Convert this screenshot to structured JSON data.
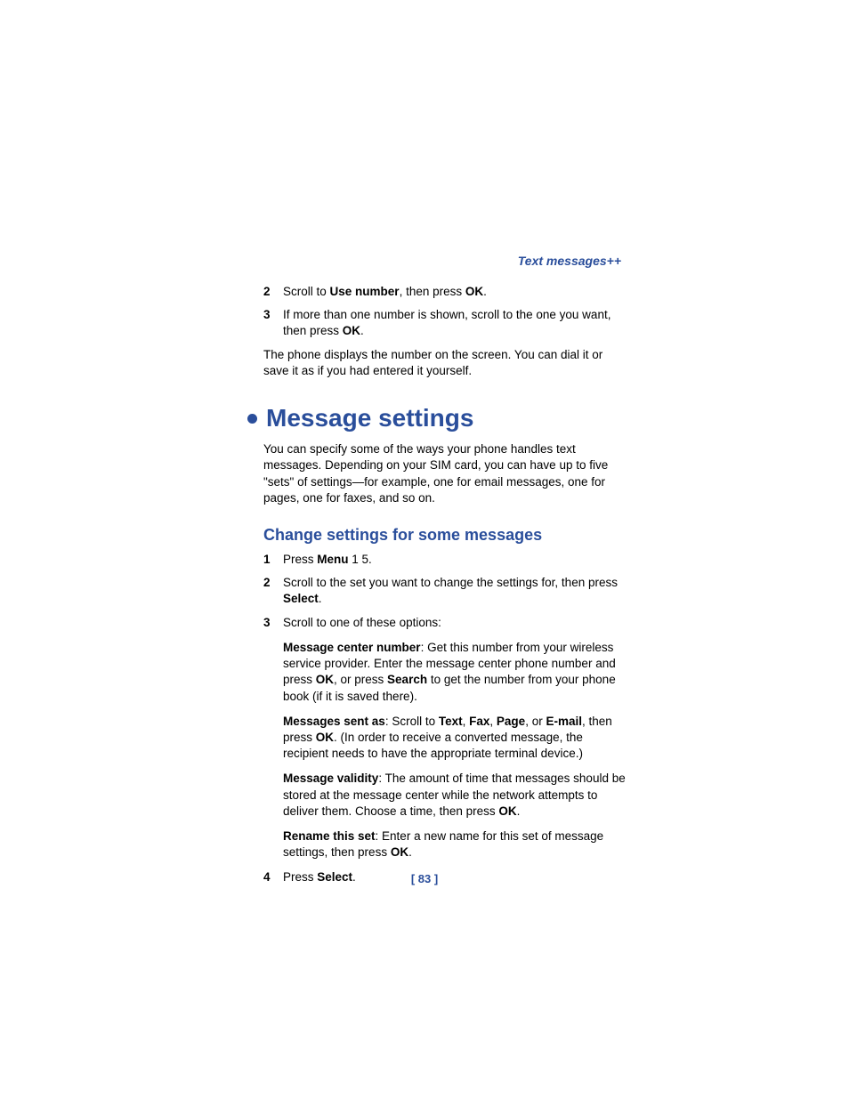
{
  "header": "Text messages++",
  "intro_steps": [
    {
      "num": "2",
      "pre": "Scroll to ",
      "bold1": "Use number",
      "mid": ", then press ",
      "bold2": "OK",
      "post": "."
    },
    {
      "num": "3",
      "pre": "If more than one number is shown, scroll to the one you want, then press ",
      "bold1": "OK",
      "mid": "",
      "bold2": "",
      "post": "."
    }
  ],
  "intro_para": "The phone displays the number on the screen. You can dial it or save it as if you had entered it yourself.",
  "h1": "Message settings",
  "h1_para": "You can specify some of the ways your phone handles text messages. Depending on your SIM card, you can have up to five \"sets\" of settings—for example, one for email messages, one for pages, one for faxes, and so on.",
  "h2": "Change settings for some messages",
  "steps": {
    "s1": {
      "num": "1",
      "press": "Press ",
      "menu": "Menu",
      "tail": " 1 5."
    },
    "s2": {
      "num": "2",
      "pre": "Scroll to the set you want to change the settings for, then press ",
      "bold": "Select",
      "post": "."
    },
    "s3": {
      "num": "3",
      "text": "Scroll to one of these options:"
    },
    "s4": {
      "num": "4",
      "press": "Press ",
      "bold": "Select",
      "post": "."
    }
  },
  "options": {
    "o1": {
      "label": "Message center number",
      "t1": ":  Get this number from your wireless service provider. Enter the message center phone number and press ",
      "b1": "OK",
      "t2": ", or press ",
      "b2": "Search",
      "t3": " to get the number from your phone book (if it is saved there)."
    },
    "o2": {
      "label": "Messages sent as",
      "t1": ":  Scroll to ",
      "b1": "Text",
      "t2": ", ",
      "b2": "Fax",
      "t3": ", ",
      "b3": "Page",
      "t4": ", or ",
      "b4": "E-mail",
      "t5": ", then press ",
      "b5": "OK",
      "t6": ". (In order to receive a converted message, the recipient needs to have the appropriate terminal device.)"
    },
    "o3": {
      "label": "Message validity",
      "t1": ":  The amount of time that messages should be stored at the message center while the network attempts to deliver them. Choose a time, then press ",
      "b1": "OK",
      "t2": "."
    },
    "o4": {
      "label": "Rename this set",
      "t1": ":  Enter a new name for this set of message settings, then press ",
      "b1": "OK",
      "t2": "."
    }
  },
  "page_num": "[ 83 ]"
}
